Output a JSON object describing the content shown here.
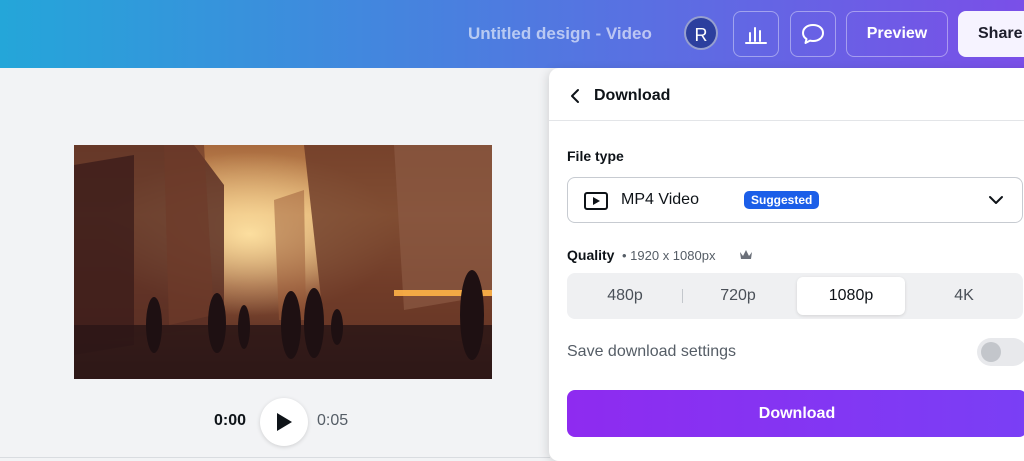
{
  "header": {
    "title": "Untitled design - Video",
    "avatar_initial": "R",
    "preview_label": "Preview",
    "share_label": "Share"
  },
  "player": {
    "current_time": "0:00",
    "end_time": "0:05"
  },
  "download_panel": {
    "title": "Download",
    "file_type_label": "File type",
    "file_type_value": "MP4 Video",
    "suggested_badge": "Suggested",
    "quality_label": "Quality",
    "quality_detail": "• 1920 x 1080px",
    "quality_options": [
      "480p",
      "720p",
      "1080p",
      "4K"
    ],
    "quality_selected": "1080p",
    "save_settings_label": "Save download settings",
    "save_settings_enabled": false,
    "download_button_label": "Download"
  },
  "colors": {
    "accent": "#7d3cf3",
    "badge": "#1b5ee8",
    "header_gradient_start": "#24a6d9",
    "header_gradient_end": "#7a4fe8"
  },
  "icons": [
    "analytics-icon",
    "comment-icon",
    "back-chevron-icon",
    "play-icon",
    "video-file-icon",
    "chevron-down-icon",
    "crown-icon"
  ]
}
